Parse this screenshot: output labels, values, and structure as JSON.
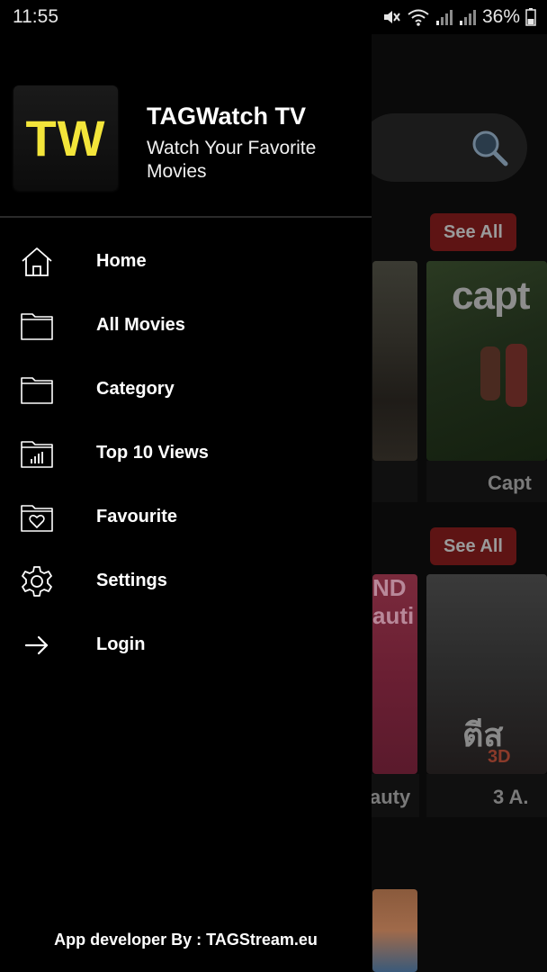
{
  "status_bar": {
    "time": "11:55",
    "battery": "36%",
    "icons": [
      "mute-icon",
      "wifi-icon",
      "signal-icon",
      "signal-icon",
      "battery-icon"
    ]
  },
  "drawer": {
    "logo_text": "TW",
    "app_name": "TAGWatch TV",
    "tagline": "Watch Your Favorite Movies",
    "menu": [
      {
        "label": "Home",
        "icon": "home-icon"
      },
      {
        "label": "All Movies",
        "icon": "folder-icon"
      },
      {
        "label": "Category",
        "icon": "folder-icon"
      },
      {
        "label": "Top 10 Views",
        "icon": "chart-folder-icon"
      },
      {
        "label": "Favourite",
        "icon": "heart-folder-icon"
      },
      {
        "label": "Settings",
        "icon": "gear-icon"
      },
      {
        "label": "Login",
        "icon": "arrow-right-icon"
      }
    ],
    "footer": "App developer By : TAGStream.eu"
  },
  "background": {
    "search_icon": "search-icon",
    "see_all_1": "See All",
    "see_all_2": "See All",
    "movie_1_title": "Capt",
    "movie_2_title": "auty",
    "movie_3_title": "3 A.",
    "poster_2_text": "capt",
    "poster_3_text": "ND\nauti",
    "poster_4_text": "ตีส",
    "poster_4_sub": "3D"
  },
  "colors": {
    "accent_logo": "#f3e53a",
    "see_all_bg": "#5e1414",
    "drawer_bg": "#000000"
  }
}
